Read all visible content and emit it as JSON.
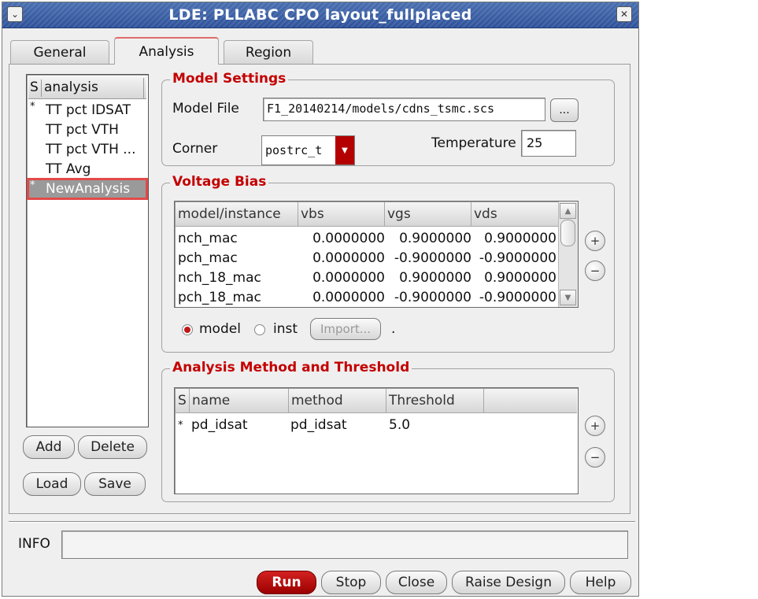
{
  "window": {
    "title": "LDE: PLLABC CPO layout_fullplaced",
    "menu_glyph": "⌄",
    "close_glyph": "✕"
  },
  "tabs": [
    {
      "label": "General"
    },
    {
      "label": "Analysis"
    },
    {
      "label": "Region"
    }
  ],
  "analysis_list": {
    "col_s": "S",
    "col_name": "analysis",
    "items": [
      {
        "mark": "*",
        "label": "TT pct IDSAT"
      },
      {
        "mark": "",
        "label": "TT pct VTH"
      },
      {
        "mark": "",
        "label": "TT pct VTH ..."
      },
      {
        "mark": "",
        "label": "TT Avg"
      },
      {
        "mark": "*",
        "label": "NewAnalysis"
      }
    ],
    "buttons": {
      "add": "Add",
      "delete": "Delete",
      "load": "Load",
      "save": "Save"
    }
  },
  "model_settings": {
    "title": "Model Settings",
    "model_file_label": "Model File",
    "model_file_value": "F1_20140214/models/cdns_tsmc.scs",
    "browse_label": "...",
    "corner_label": "Corner",
    "corner_value": "postrc_t",
    "temperature_label": "Temperature",
    "temperature_value": "25"
  },
  "voltage_bias": {
    "title": "Voltage Bias",
    "columns": [
      "model/instance",
      "vbs",
      "vgs",
      "vds"
    ],
    "rows": [
      [
        "nch_mac",
        "0.0000000",
        "0.9000000",
        "0.9000000"
      ],
      [
        "pch_mac",
        "0.0000000",
        "-0.9000000",
        "-0.9000000"
      ],
      [
        "nch_18_mac",
        "0.0000000",
        "0.9000000",
        "0.9000000"
      ],
      [
        "pch_18_mac",
        "0.0000000",
        "-0.9000000",
        "-0.9000000"
      ]
    ],
    "radio_model": "model",
    "radio_inst": "inst",
    "import_label": "Import...",
    "trailing": ".",
    "plus": "+",
    "minus": "−"
  },
  "analysis_method": {
    "title": "Analysis Method and Threshold",
    "columns": [
      "S",
      "name",
      "method",
      "Threshold"
    ],
    "rows": [
      [
        "*",
        "pd_idsat",
        "pd_idsat",
        "5.0"
      ]
    ],
    "plus": "+",
    "minus": "−"
  },
  "info": {
    "label": "INFO",
    "value": ""
  },
  "footer": {
    "run": "Run",
    "stop": "Stop",
    "close": "Close",
    "raise_design": "Raise Design",
    "help": "Help"
  },
  "colors": {
    "accent_red": "#c40000",
    "titlebar_blue": "#3a5ea5",
    "selection_outline": "#e24a4a"
  }
}
